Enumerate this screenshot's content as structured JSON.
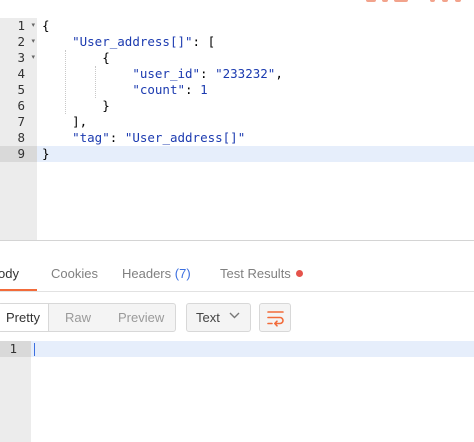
{
  "request_editor": {
    "lines": [
      {
        "n": "1",
        "fold": true
      },
      {
        "n": "2",
        "fold": true
      },
      {
        "n": "3",
        "fold": true
      },
      {
        "n": "4",
        "fold": false
      },
      {
        "n": "5",
        "fold": false
      },
      {
        "n": "6",
        "fold": false
      },
      {
        "n": "7",
        "fold": false
      },
      {
        "n": "8",
        "fold": false
      },
      {
        "n": "9",
        "fold": false
      }
    ],
    "active_line": "9",
    "code": {
      "open_brace": "{",
      "user_address_key": "\"User_address[]\"",
      "colon_bracket": ": [",
      "inner_open": "{",
      "user_id_key": "\"user_id\"",
      "user_id_value": "\"233232\"",
      "count_key": "\"count\"",
      "count_value": "1",
      "inner_close": "}",
      "bracket_close": "],",
      "tag_key": "\"tag\"",
      "tag_value": "\"User_address[]\"",
      "close_brace": "}"
    }
  },
  "response_tabs": {
    "body": "ody",
    "cookies": "Cookies",
    "headers": "Headers",
    "headers_count": "(7)",
    "test_results": "Test Results"
  },
  "response_toolbar": {
    "pretty": "Pretty",
    "raw": "Raw",
    "preview": "Preview",
    "format": "Text",
    "chevron_icon": "chevron-down-icon",
    "wrap_icon": "wrap-lines-icon"
  },
  "response_editor": {
    "line_number": "1"
  },
  "colors": {
    "accent": "#f26b3a",
    "count_blue": "#3b6fe0",
    "status_dot": "#e5534b",
    "json_string": "#1c3bb0"
  }
}
